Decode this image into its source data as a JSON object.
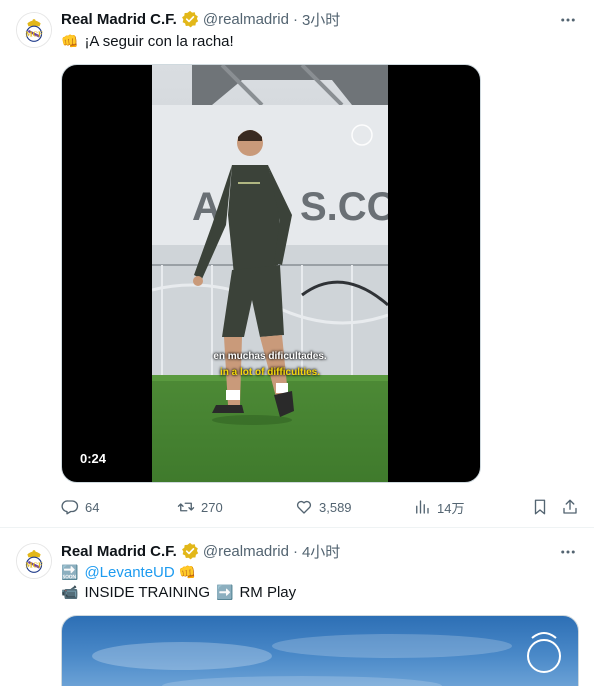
{
  "tweets": [
    {
      "author_name": "Real Madrid C.F.",
      "handle": "@realmadrid",
      "separator": "·",
      "time": "3小时",
      "text": "¡A seguir con la racha!",
      "text_emoji": "👊",
      "video": {
        "duration": "0:24",
        "subtitle_es": "en muchas dificultades.",
        "subtitle_en": "in a lot of difficulties."
      },
      "stats": {
        "replies": "64",
        "retweets": "270",
        "likes": "3,589",
        "views": "14万"
      }
    },
    {
      "author_name": "Real Madrid C.F.",
      "handle": "@realmadrid",
      "separator": "·",
      "time": "4小时",
      "line1_emoji": "🔜",
      "line1_mention": "@LevanteUD",
      "line1_end_emoji": "👊",
      "line2_emoji": "📹",
      "line2_text": "INSIDE TRAINING",
      "line2_arrow": "➡️",
      "line2_end": "RM Play"
    }
  ],
  "icons": {
    "more": "more-horizontal-icon",
    "verified": "verified-badge-icon",
    "reply": "reply-icon",
    "retweet": "retweet-icon",
    "like": "heart-icon",
    "views": "views-icon",
    "bookmark": "bookmark-icon",
    "share": "share-icon"
  },
  "colors": {
    "primary_text": "#0f1419",
    "secondary_text": "#536471",
    "link": "#1d9bf0",
    "verified_gold": "#e2b719",
    "subtitle_yellow": "#f5d90a"
  }
}
